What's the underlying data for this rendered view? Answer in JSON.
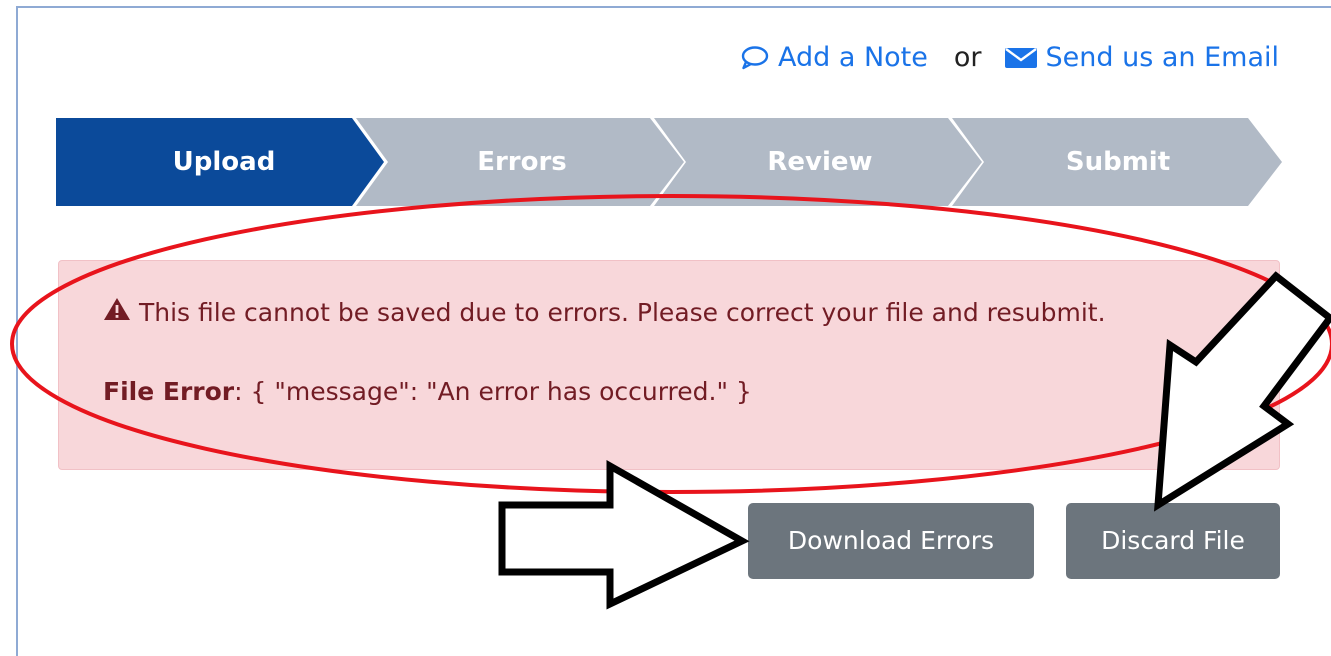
{
  "header_links": {
    "note_label": "Add a Note",
    "separator": "or",
    "email_label": "Send us an Email",
    "link_color": "#1a73e8"
  },
  "steps": [
    {
      "label": "Upload",
      "state": "active"
    },
    {
      "label": "Errors",
      "state": "inactive"
    },
    {
      "label": "Review",
      "state": "inactive"
    },
    {
      "label": "Submit",
      "state": "inactive"
    }
  ],
  "step_colors": {
    "active": "#0b4a9a",
    "inactive": "#b1bac6"
  },
  "alert": {
    "message": "This file cannot be saved due to errors. Please correct your file and resubmit.",
    "error_label": "File Error",
    "error_detail": ": { \"message\": \"An error has occurred.\" }",
    "icon": "warning-triangle-icon",
    "background": "#f8d7da",
    "text_color": "#721c24"
  },
  "buttons": {
    "download_errors": "Download Errors",
    "discard_file": "Discard File",
    "color": "#6c757d"
  },
  "annotations": {
    "highlight": "red-ellipse",
    "arrows": [
      "arrow-to-download-errors",
      "arrow-to-discard-file"
    ]
  }
}
